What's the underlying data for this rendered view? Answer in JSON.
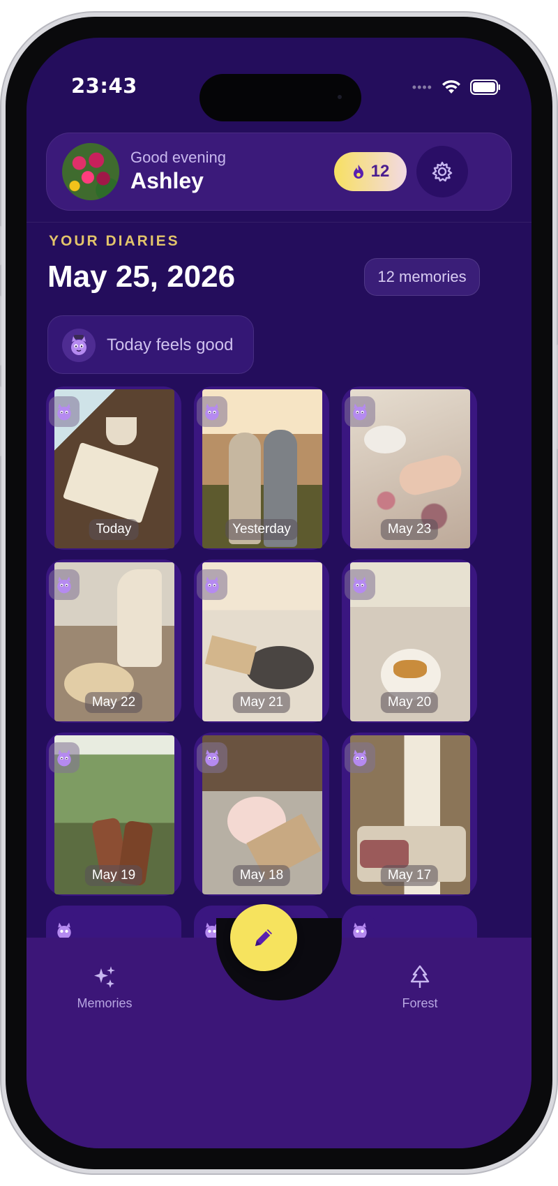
{
  "status": {
    "time": "23:43"
  },
  "header": {
    "greeting": "Good evening",
    "name": "Ashley",
    "streak_count": "12"
  },
  "diaries": {
    "section_label": "YOUR DIARIES",
    "date": "May 25, 2026",
    "memories_count": "12 memories",
    "mood_text": "Today feels good"
  },
  "cards": [
    {
      "label": "Today"
    },
    {
      "label": "Yesterday"
    },
    {
      "label": "May 23"
    },
    {
      "label": "May 22"
    },
    {
      "label": "May 21"
    },
    {
      "label": "May 20"
    },
    {
      "label": "May 19"
    },
    {
      "label": "May 18"
    },
    {
      "label": "May 17"
    }
  ],
  "nav": {
    "memories_label": "Memories",
    "forest_label": "Forest"
  },
  "colors": {
    "background": "#240d5c",
    "accent_yellow": "#f6e35e",
    "section_label": "#e2c46b"
  },
  "icons": {
    "streak": "flame-icon",
    "settings": "gear-icon",
    "mood": "pet-icon",
    "fab": "pencil-icon",
    "memories": "sparkles-icon",
    "forest": "tree-icon"
  }
}
